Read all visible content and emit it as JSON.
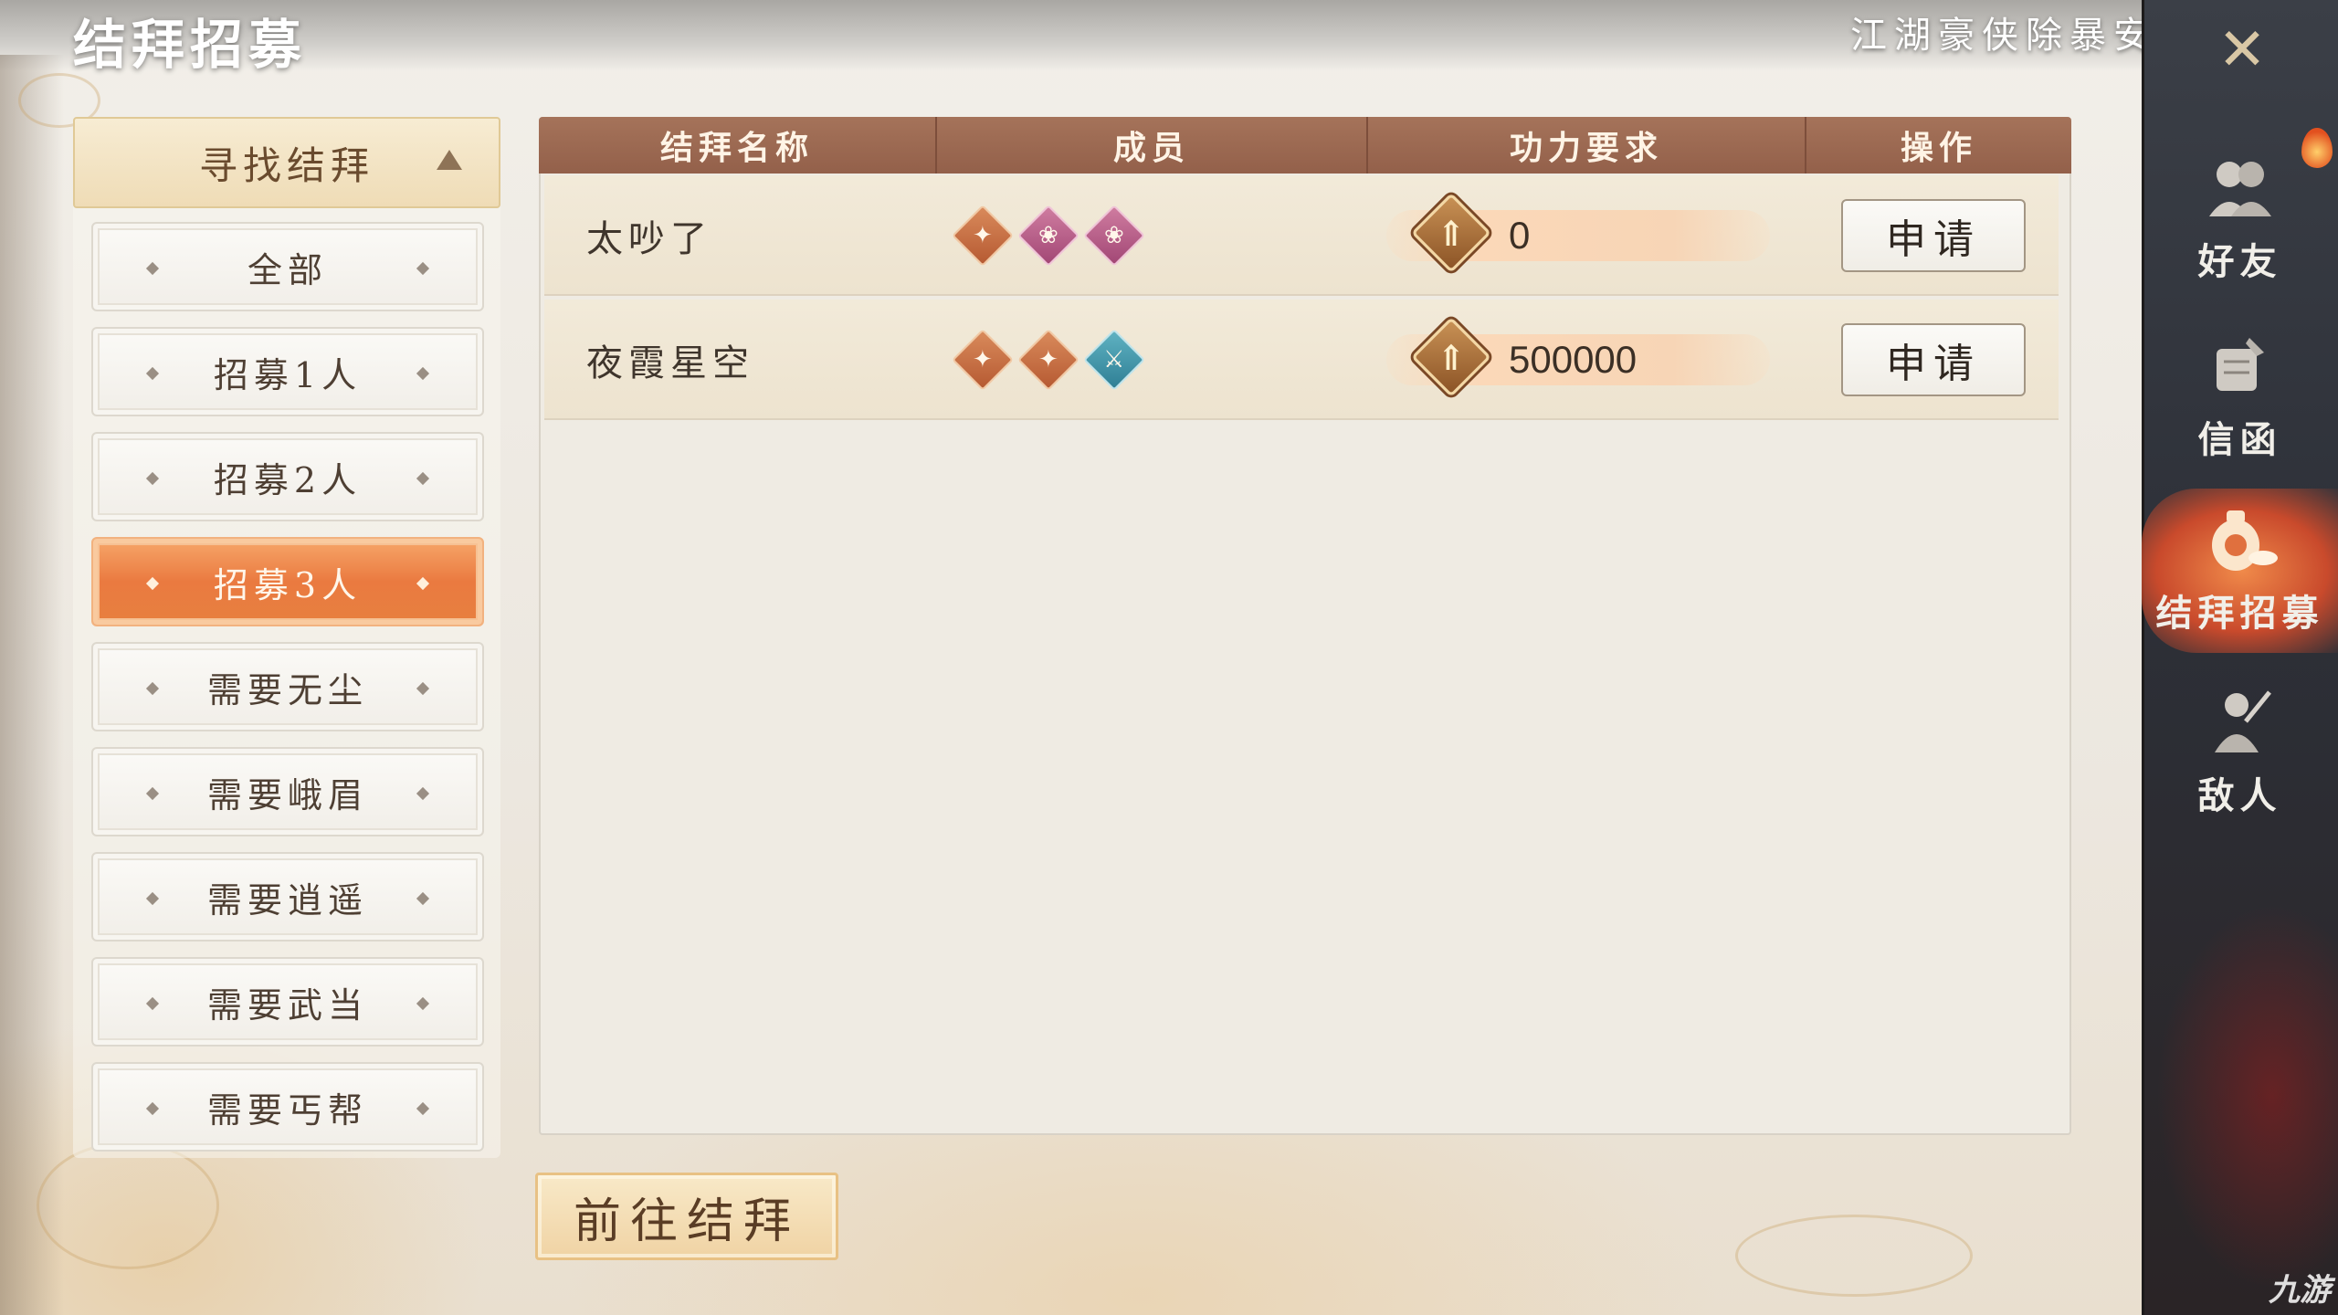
{
  "header": {
    "title": "结拜招募",
    "slogan": "江湖豪侠除暴安良"
  },
  "filter_panel": {
    "header_label": "寻找结拜",
    "items": [
      {
        "label": "全部",
        "active": false
      },
      {
        "label": "招募1人",
        "active": false
      },
      {
        "label": "招募2人",
        "active": false
      },
      {
        "label": "招募3人",
        "active": true
      },
      {
        "label": "需要无尘",
        "active": false
      },
      {
        "label": "需要峨眉",
        "active": false
      },
      {
        "label": "需要逍遥",
        "active": false
      },
      {
        "label": "需要武当",
        "active": false
      },
      {
        "label": "需要丐帮",
        "active": false
      }
    ]
  },
  "table": {
    "columns": [
      "结拜名称",
      "成员",
      "功力要求",
      "操作"
    ],
    "rows": [
      {
        "name": "太吵了",
        "members": [
          {
            "icon": "sect-orange-icon",
            "color": "#c46c40"
          },
          {
            "icon": "lotus-pink-icon",
            "color": "#b35a85"
          },
          {
            "icon": "lotus-pink-icon",
            "color": "#b35a85"
          }
        ],
        "power": "0",
        "action": "申请"
      },
      {
        "name": "夜霞星空",
        "members": [
          {
            "icon": "sect-orange-icon",
            "color": "#c46c40"
          },
          {
            "icon": "sect-orange-icon",
            "color": "#c46c40"
          },
          {
            "icon": "sword-teal-icon",
            "color": "#3f93a8"
          }
        ],
        "power": "500000",
        "action": "申请"
      }
    ]
  },
  "footer": {
    "go_button": "前往结拜"
  },
  "sidebar": {
    "items": [
      {
        "label": "好友",
        "icon": "friends-icon",
        "active": false
      },
      {
        "label": "信函",
        "icon": "letter-icon",
        "active": false
      },
      {
        "label": "结拜招募",
        "icon": "wine-jar-icon",
        "active": true
      },
      {
        "label": "敌人",
        "icon": "enemy-icon",
        "active": false
      }
    ]
  },
  "colors": {
    "header_bar": "#9a6650",
    "active_filter": "#ea7a40",
    "sidebar_bg": "#2d3038",
    "active_nav": "#d9603a"
  },
  "watermark": "九游"
}
